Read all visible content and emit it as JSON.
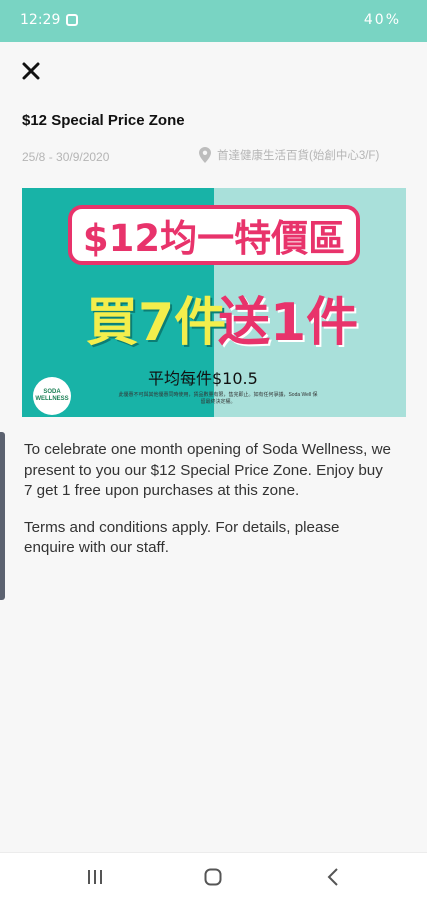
{
  "status_bar": {
    "time": "12:29",
    "right_text": "40%",
    "bg_color": "#79d4c3"
  },
  "header": {
    "close_icon": "close-icon",
    "title": "$12 Special Price Zone"
  },
  "meta": {
    "date_range": "25/8 - 30/9/2020",
    "location": "首達健康生活百貨(始創中心3/F)"
  },
  "banner": {
    "headline": "$12均一特價區",
    "buy_text": "買7件",
    "free_text": "送1件",
    "average_price": "平均每件$10.5",
    "logo_text": "SODA WELLNESS",
    "fine_print": "此優惠不可與其他優惠同時使用，貨品數量有限，售完即止。如有任何爭議，Soda Well 保留最終決定權。",
    "colors": {
      "accent": "#e8336b",
      "teal": "#18b3a7",
      "light_teal": "#a9e0da",
      "yellow": "#f3ee4c"
    }
  },
  "description": {
    "paragraph1": "To celebrate one month opening of Soda Wellness, we present to you our $12 Special Price Zone. Enjoy buy 7 get 1 free upon purchases at this zone.",
    "paragraph2": "Terms and conditions apply. For details, please enquire with our staff."
  },
  "nav_bar": {
    "items": [
      "recent-apps-icon",
      "home-icon",
      "back-icon"
    ]
  }
}
